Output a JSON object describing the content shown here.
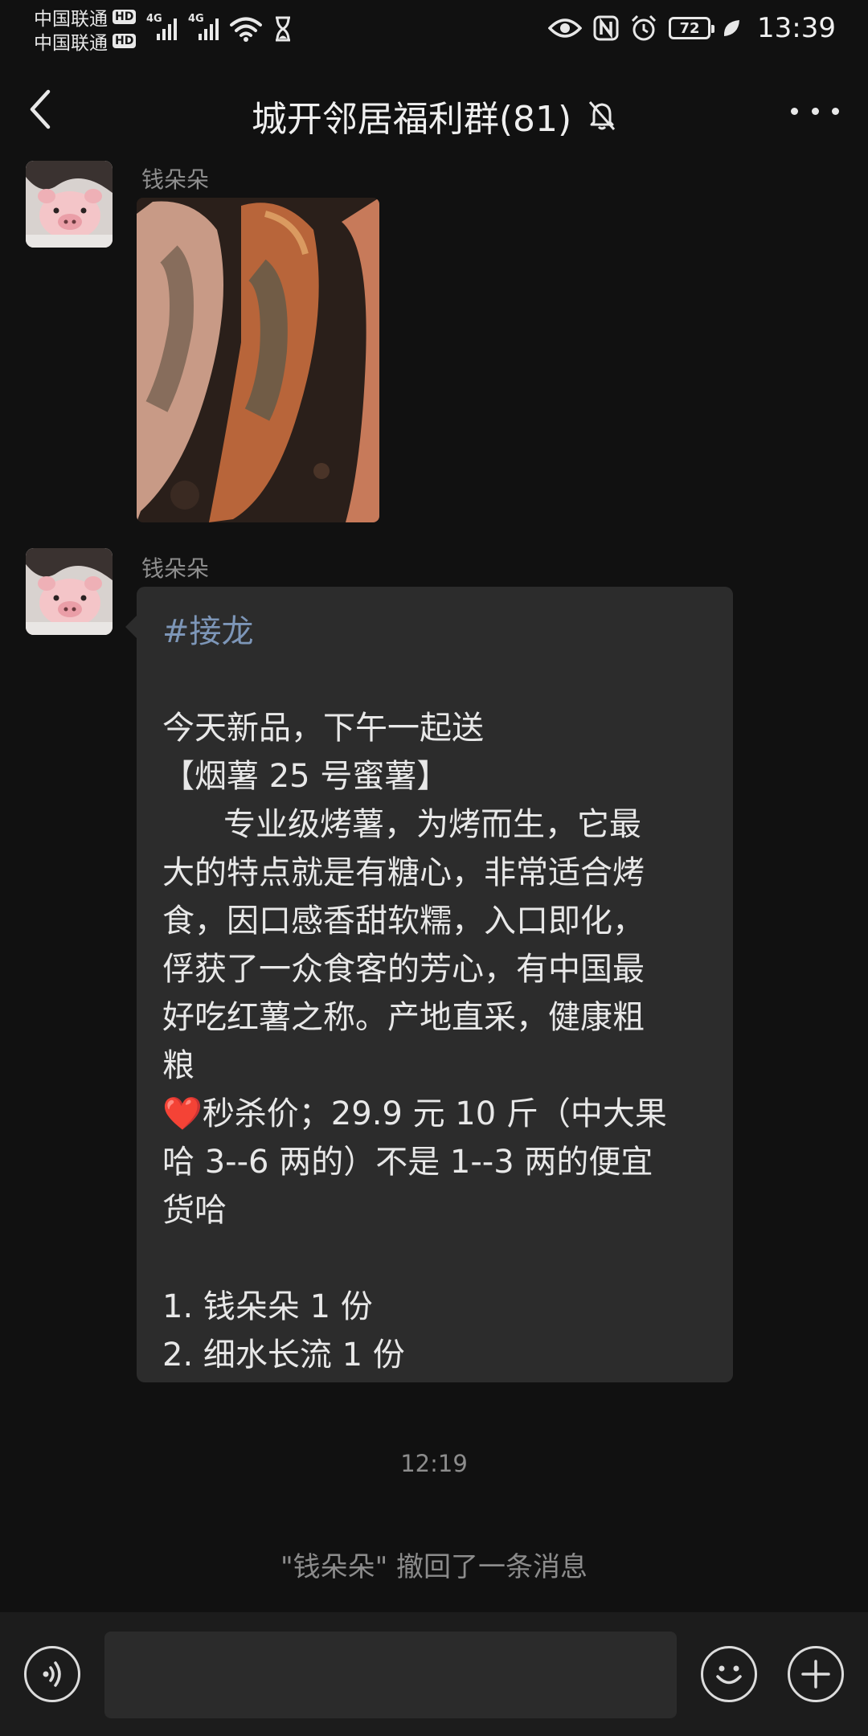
{
  "status_bar": {
    "carrier_1": "中国联通",
    "carrier_2": "中国联通",
    "hd": "HD",
    "network_1": "4G",
    "network_2": "4G",
    "battery": "72",
    "time": "13:39"
  },
  "header": {
    "title": "城开邻居福利群(81)"
  },
  "messages": [
    {
      "sender": "钱朵朵",
      "type": "image"
    },
    {
      "sender": "钱朵朵",
      "type": "text",
      "tag": "#接龙",
      "lines_1": [
        "今天新品，下午一起送",
        "【烟薯 25 号蜜薯】"
      ],
      "indent_line": "专业级烤薯，为烤而生，它最",
      "lines_2": [
        "大的特点就是有糖心，非常适合烤",
        "食，因口感香甜软糯，入口即化，",
        "俘获了一众食客的芳心，有中国最",
        "好吃红薯之称。产地直采，健康粗",
        "粮"
      ],
      "heart": "❤️",
      "price_first": "秒杀价；29.9 元 10 斤（中大果",
      "price_rest": [
        "哈 3--6 两的）不是 1--3 两的便宜",
        "货哈"
      ],
      "list": [
        "1. 钱朵朵 1 份",
        "2. 细水长流 1 份"
      ]
    }
  ],
  "timestamp": "12:19",
  "recall_notice": "\"钱朵朵\" 撤回了一条消息",
  "input": {
    "value": ""
  },
  "colors": {
    "background": "#111111",
    "bubble": "#2c2c2c",
    "tag": "#7d96b8",
    "muted": "#8c8c8c"
  }
}
